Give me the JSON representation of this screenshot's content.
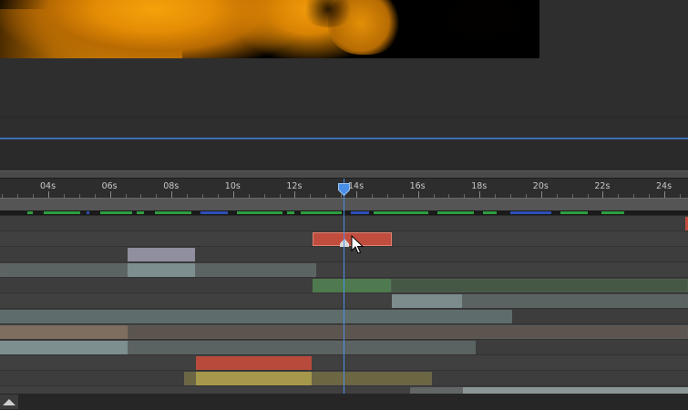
{
  "ruler": {
    "ticks": [
      "04s",
      "06s",
      "08s",
      "10s",
      "12s",
      "14s",
      "16s",
      "18s",
      "20s",
      "22s",
      "24s"
    ]
  },
  "playhead": {
    "position_seconds": 13.6
  },
  "colors": {
    "playhead": "#4a8ee6",
    "accent_line": "#3a6fb1",
    "cache_green": "#2f9e3f",
    "cache_blue": "#2d4fb8"
  },
  "layers": [
    {
      "bar_color": "#c04d3e"
    },
    {
      "bar_color": "#8f8fa0"
    },
    {
      "bar_color": "#7d8f8f"
    },
    {
      "bar_color": "#4f7a4f"
    },
    {
      "bar_color": "#7c8c8c"
    },
    {
      "bar_color": "#5f6c6c"
    },
    {
      "bar_color": "#7e6e60"
    },
    {
      "bar_color": "#7d8f8f"
    },
    {
      "bar_color": "#b84a3c"
    },
    {
      "bar_color": "#a6984a"
    },
    {
      "bar_color": "#8c9696"
    }
  ]
}
